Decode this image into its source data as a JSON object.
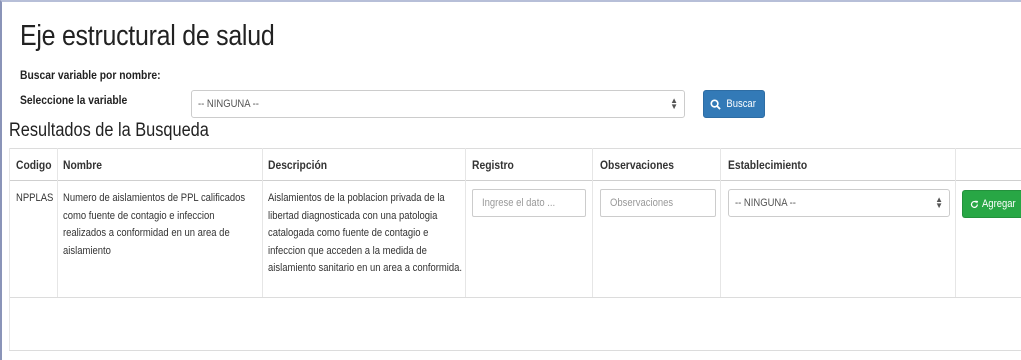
{
  "page": {
    "title": "Eje estructural de salud",
    "search_label": "Buscar variable por nombre:",
    "select_label": "Seleccione la variable",
    "select_value": "-- NINGUNA --",
    "search_button": "Buscar",
    "results_title": "Resultados de la Busqueda"
  },
  "table": {
    "headers": {
      "codigo": "Codigo",
      "nombre": "Nombre",
      "descripcion": "Descripción",
      "registro": "Registro",
      "observaciones": "Observaciones",
      "establecimiento": "Establecimiento"
    },
    "rows": [
      {
        "codigo": "NPPLAS",
        "nombre": "Numero de aislamientos de PPL calificados como fuente de contagio e infeccion realizados a conformidad en un area de aislamiento",
        "descripcion": "Aislamientos de la poblacion privada de la libertad diagnosticada con una patologia catalogada como fuente de contagio e infeccion que acceden a la medida de aislamiento sanitario en un area a conformida.",
        "registro_placeholder": "Ingrese el dato ...",
        "observaciones_placeholder": "Observaciones",
        "establecimiento_value": "-- NINGUNA --",
        "action_label": "Agregar"
      }
    ]
  },
  "icons": {
    "search": "search-icon",
    "refresh": "refresh-icon",
    "select_caret": "updown-caret-icon"
  },
  "colors": {
    "primary": "#337ab7",
    "success": "#28a745"
  }
}
